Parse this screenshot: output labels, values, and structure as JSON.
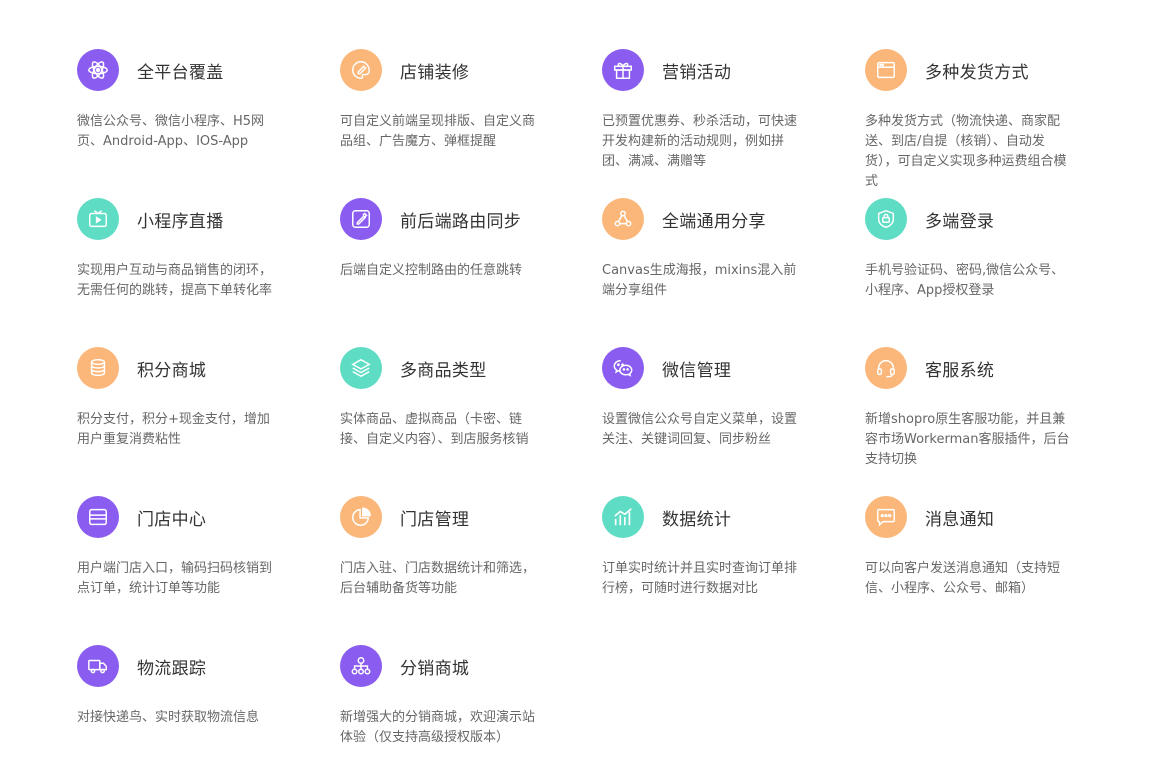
{
  "colors": {
    "purple": "#8b5cf0",
    "orange": "#fbb77a",
    "teal": "#5fdcc4"
  },
  "features": [
    {
      "title": "全平台覆盖",
      "desc": "微信公众号、微信小程序、H5网页、Android-App、IOS-App",
      "icon": "atom-icon",
      "color": "purple"
    },
    {
      "title": "店铺装修",
      "desc": "可自定义前端呈现排版、自定义商品组、广告魔方、弹框提醒",
      "icon": "palette-brush-icon",
      "color": "orange"
    },
    {
      "title": "营销活动",
      "desc": "已预置优惠券、秒杀活动，可快速开发构建新的活动规则，例如拼团、满减、满赠等",
      "icon": "gift-icon",
      "color": "purple"
    },
    {
      "title": "多种发货方式",
      "desc": "多种发货方式（物流快递、商家配送、到店/自提（核销）、自动发货），可自定义实现多种运费组合模式",
      "icon": "browser-window-icon",
      "color": "orange"
    },
    {
      "title": "小程序直播",
      "desc": "实现用户互动与商品销售的闭环，无需任何的跳转，提高下单转化率",
      "icon": "tv-play-icon",
      "color": "teal"
    },
    {
      "title": "前后端路由同步",
      "desc": " 后端自定义控制路由的任意跳转",
      "icon": "link-edit-icon",
      "color": "purple"
    },
    {
      "title": "全端通用分享",
      "desc": "Canvas生成海报，mixins混入前端分享组件",
      "icon": "share-nodes-icon",
      "color": "orange"
    },
    {
      "title": "多端登录",
      "desc": "手机号验证码、密码,微信公众号、小程序、App授权登录",
      "icon": "shield-check-icon",
      "color": "teal"
    },
    {
      "title": "积分商城",
      "desc": "积分支付，积分+现金支付，增加用户重复消费粘性",
      "icon": "coins-stack-icon",
      "color": "orange"
    },
    {
      "title": "多商品类型",
      "desc": "实体商品、虚拟商品（卡密、链接、自定义内容）、到店服务核销",
      "icon": "layers-icon",
      "color": "teal"
    },
    {
      "title": "微信管理",
      "desc": "设置微信公众号自定义菜单，设置关注、关键词回复、同步粉丝",
      "icon": "wechat-icon",
      "color": "purple"
    },
    {
      "title": "客服系统",
      "desc": "新增shopro原生客服功能，并且兼容市场Workerman客服插件，后台支持切换",
      "icon": "headset-icon",
      "color": "orange"
    },
    {
      "title": "门店中心",
      "desc": "用户端门店入口，输码扫码核销到点订单，统计订单等功能",
      "icon": "card-icon",
      "color": "purple"
    },
    {
      "title": "门店管理",
      "desc": "门店入驻、门店数据统计和筛选，后台辅助备货等功能",
      "icon": "pie-chart-icon",
      "color": "orange"
    },
    {
      "title": "数据统计",
      "desc": "订单实时统计并且实时查询订单排行榜，可随时进行数据对比",
      "icon": "bar-chart-icon",
      "color": "teal"
    },
    {
      "title": "消息通知",
      "desc": "可以向客户发送消息通知（支持短信、小程序、公众号、邮箱）",
      "icon": "chat-bubble-icon",
      "color": "orange"
    },
    {
      "title": "物流跟踪",
      "desc": " 对接快递鸟、实时获取物流信息",
      "icon": "truck-icon",
      "color": "purple"
    },
    {
      "title": "分销商城",
      "desc": "新增强大的分销商城，欢迎演示站体验（仅支持高级授权版本）",
      "icon": "org-tree-icon",
      "color": "purple"
    }
  ]
}
